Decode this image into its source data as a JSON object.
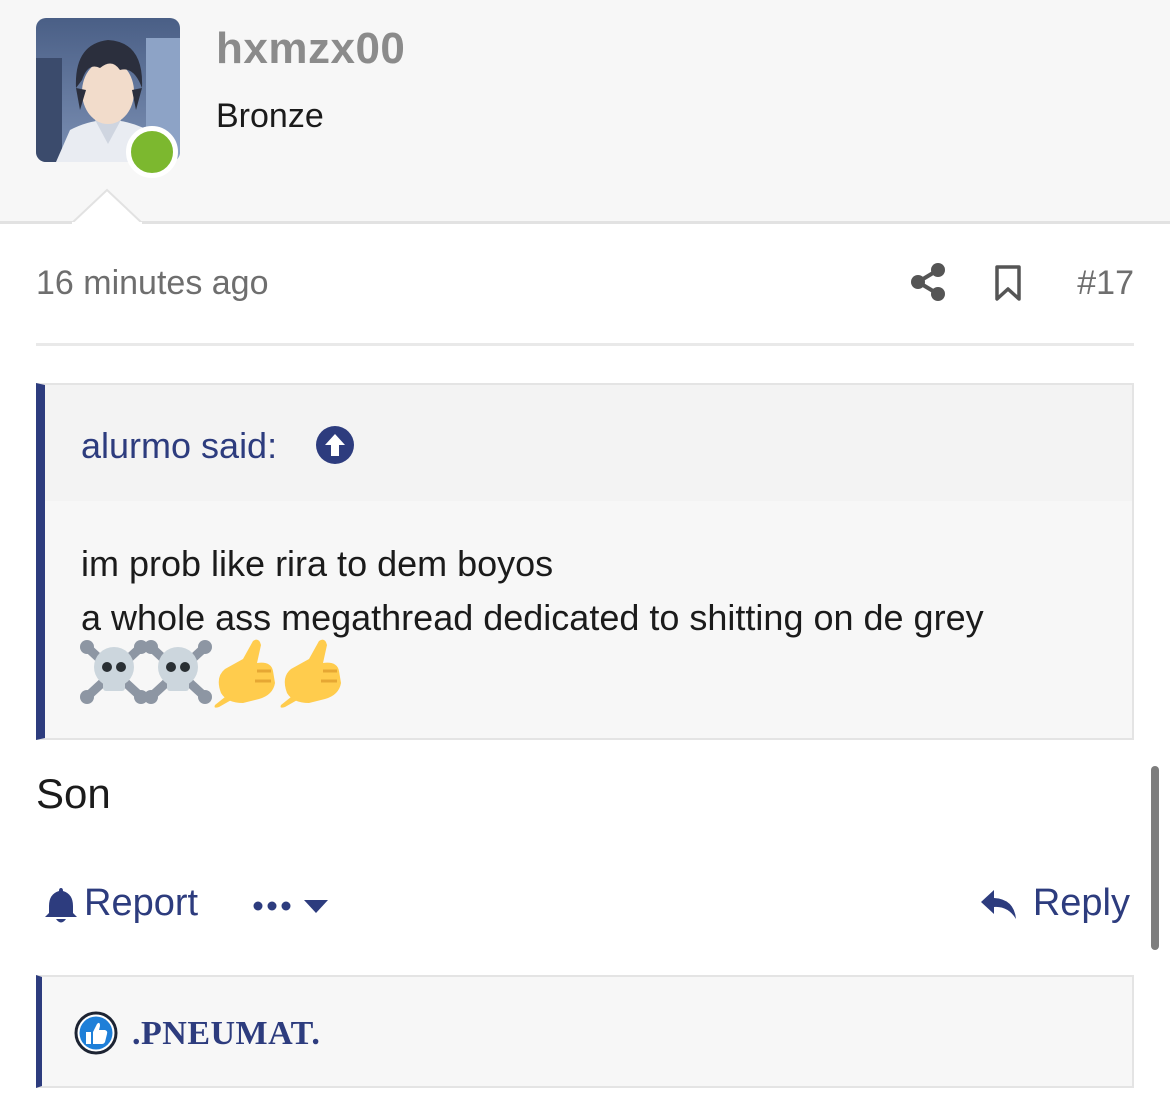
{
  "post": {
    "username": "hxmzx00",
    "user_title": "Bronze",
    "time": "16 minutes ago",
    "number": "#17",
    "body": "Son"
  },
  "quote": {
    "author_label": "alurmo said:",
    "lines": [
      "im prob like rira to dem boyos",
      "a whole ass megathread dedicated to shitting on de grey"
    ],
    "emojis": [
      "skull-and-crossbones",
      "skull-and-crossbones",
      "call-me-hand",
      "call-me-hand"
    ]
  },
  "actions": {
    "report_label": "Report",
    "reply_label": "Reply"
  },
  "reaction": {
    "user": ".PNEUMAT."
  },
  "colors": {
    "accent": "#2d3c7e",
    "online": "#7cb82f",
    "muted_text": "#6e6e6e",
    "username_text": "#8b8b8b"
  },
  "icons": [
    "share-icon",
    "bookmark-icon",
    "quote-up-arrow-icon",
    "bell-icon",
    "more-dots-icon",
    "reply-icon",
    "like-icon"
  ]
}
